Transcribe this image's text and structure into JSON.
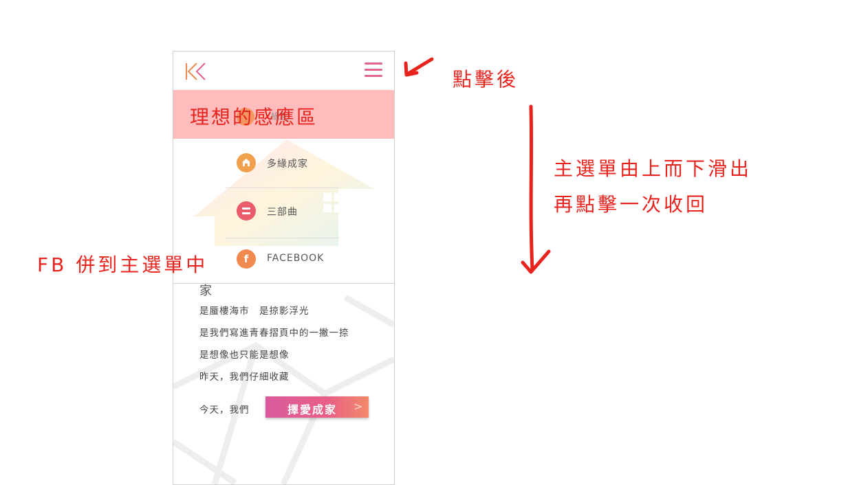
{
  "header": {
    "logo_icon": "k-logo-icon",
    "menu_icon": "hamburger-icon"
  },
  "highlight": {
    "text": "理想的感應區",
    "faint_label": "緣起"
  },
  "menu": {
    "items": [
      {
        "label": "多緣成家",
        "icon": "home-icon",
        "color": "#f1a14d"
      },
      {
        "label": "三部曲",
        "icon": "equals-icon",
        "color": "#ea5b6c"
      },
      {
        "label": "FACEBOOK",
        "icon": "facebook-icon",
        "color": "#f08a4e"
      }
    ]
  },
  "content": {
    "heading_partial": "家",
    "lines": [
      "是蜃樓海市　是掠影浮光",
      "是我們寫進青春摺頁中的一撇一捺",
      "是想像也只能是想像",
      "昨天，我們仔細收藏"
    ],
    "last_line": "今天，我們",
    "cta_label": "擇愛成家",
    "cta_arrow": ">"
  },
  "annotations": {
    "after_click": "點擊後",
    "menu_slide_1": "主選單由上而下滑出",
    "menu_slide_2": "再點擊一次收回",
    "fb_note": "FB 併到主選單中"
  },
  "colors": {
    "accent_pink": "#e0628f",
    "highlight_bg": "#ffbcbc",
    "annotation_red": "#e8221c"
  }
}
